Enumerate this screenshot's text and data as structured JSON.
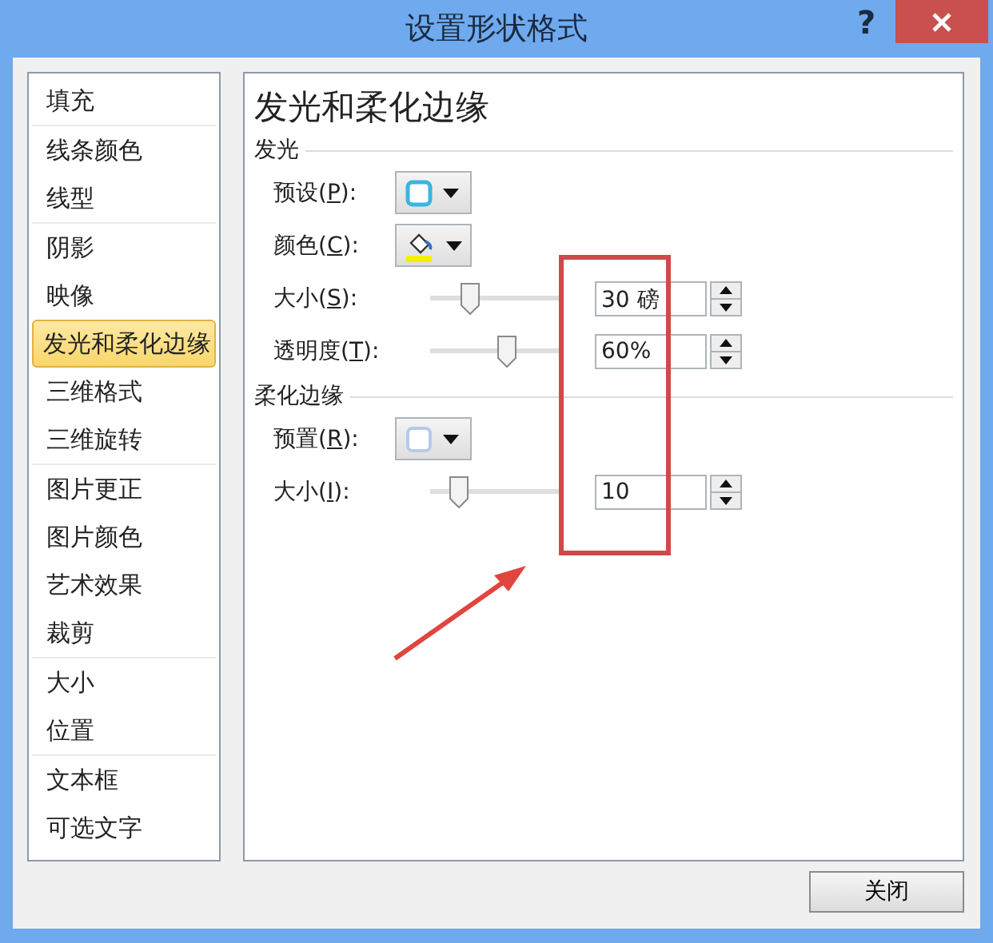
{
  "window": {
    "title": "设置形状格式",
    "help": "?"
  },
  "sidebar": {
    "groups": [
      {
        "items": [
          {
            "label": "填充",
            "selected": false
          }
        ]
      },
      {
        "items": [
          {
            "label": "线条颜色",
            "selected": false
          },
          {
            "label": "线型",
            "selected": false
          }
        ]
      },
      {
        "items": [
          {
            "label": "阴影",
            "selected": false
          },
          {
            "label": "映像",
            "selected": false
          },
          {
            "label": "发光和柔化边缘",
            "selected": true
          },
          {
            "label": "三维格式",
            "selected": false
          },
          {
            "label": "三维旋转",
            "selected": false
          }
        ]
      },
      {
        "items": [
          {
            "label": "图片更正",
            "selected": false
          },
          {
            "label": "图片颜色",
            "selected": false
          },
          {
            "label": "艺术效果",
            "selected": false
          },
          {
            "label": "裁剪",
            "selected": false
          }
        ]
      },
      {
        "items": [
          {
            "label": "大小",
            "selected": false
          },
          {
            "label": "位置",
            "selected": false
          }
        ]
      },
      {
        "items": [
          {
            "label": "文本框",
            "selected": false
          },
          {
            "label": "可选文字",
            "selected": false
          }
        ]
      }
    ]
  },
  "panel": {
    "title": "发光和柔化边缘",
    "sections": [
      {
        "title": "发光",
        "rows": [
          {
            "kind": "glow-preset",
            "label": "预设(",
            "hotkey": "P",
            "tail": "):"
          },
          {
            "kind": "color",
            "label": "颜色(",
            "hotkey": "C",
            "tail": "):"
          },
          {
            "kind": "slider",
            "label": "大小(",
            "hotkey": "S",
            "tail": "):",
            "level": 0.27,
            "value": "30 磅"
          },
          {
            "kind": "slider",
            "label": "透明度(",
            "hotkey": "T",
            "tail": "):",
            "level": 0.6,
            "value": "60%"
          }
        ]
      },
      {
        "title": "柔化边缘",
        "rows": [
          {
            "kind": "soft-preset",
            "label": "预置(",
            "hotkey": "R",
            "tail": "):"
          },
          {
            "kind": "slider",
            "label": "大小(",
            "hotkey": "I",
            "tail": "):",
            "level": 0.17,
            "value": "10"
          }
        ]
      }
    ]
  },
  "footer": {
    "close_button": "关闭"
  }
}
